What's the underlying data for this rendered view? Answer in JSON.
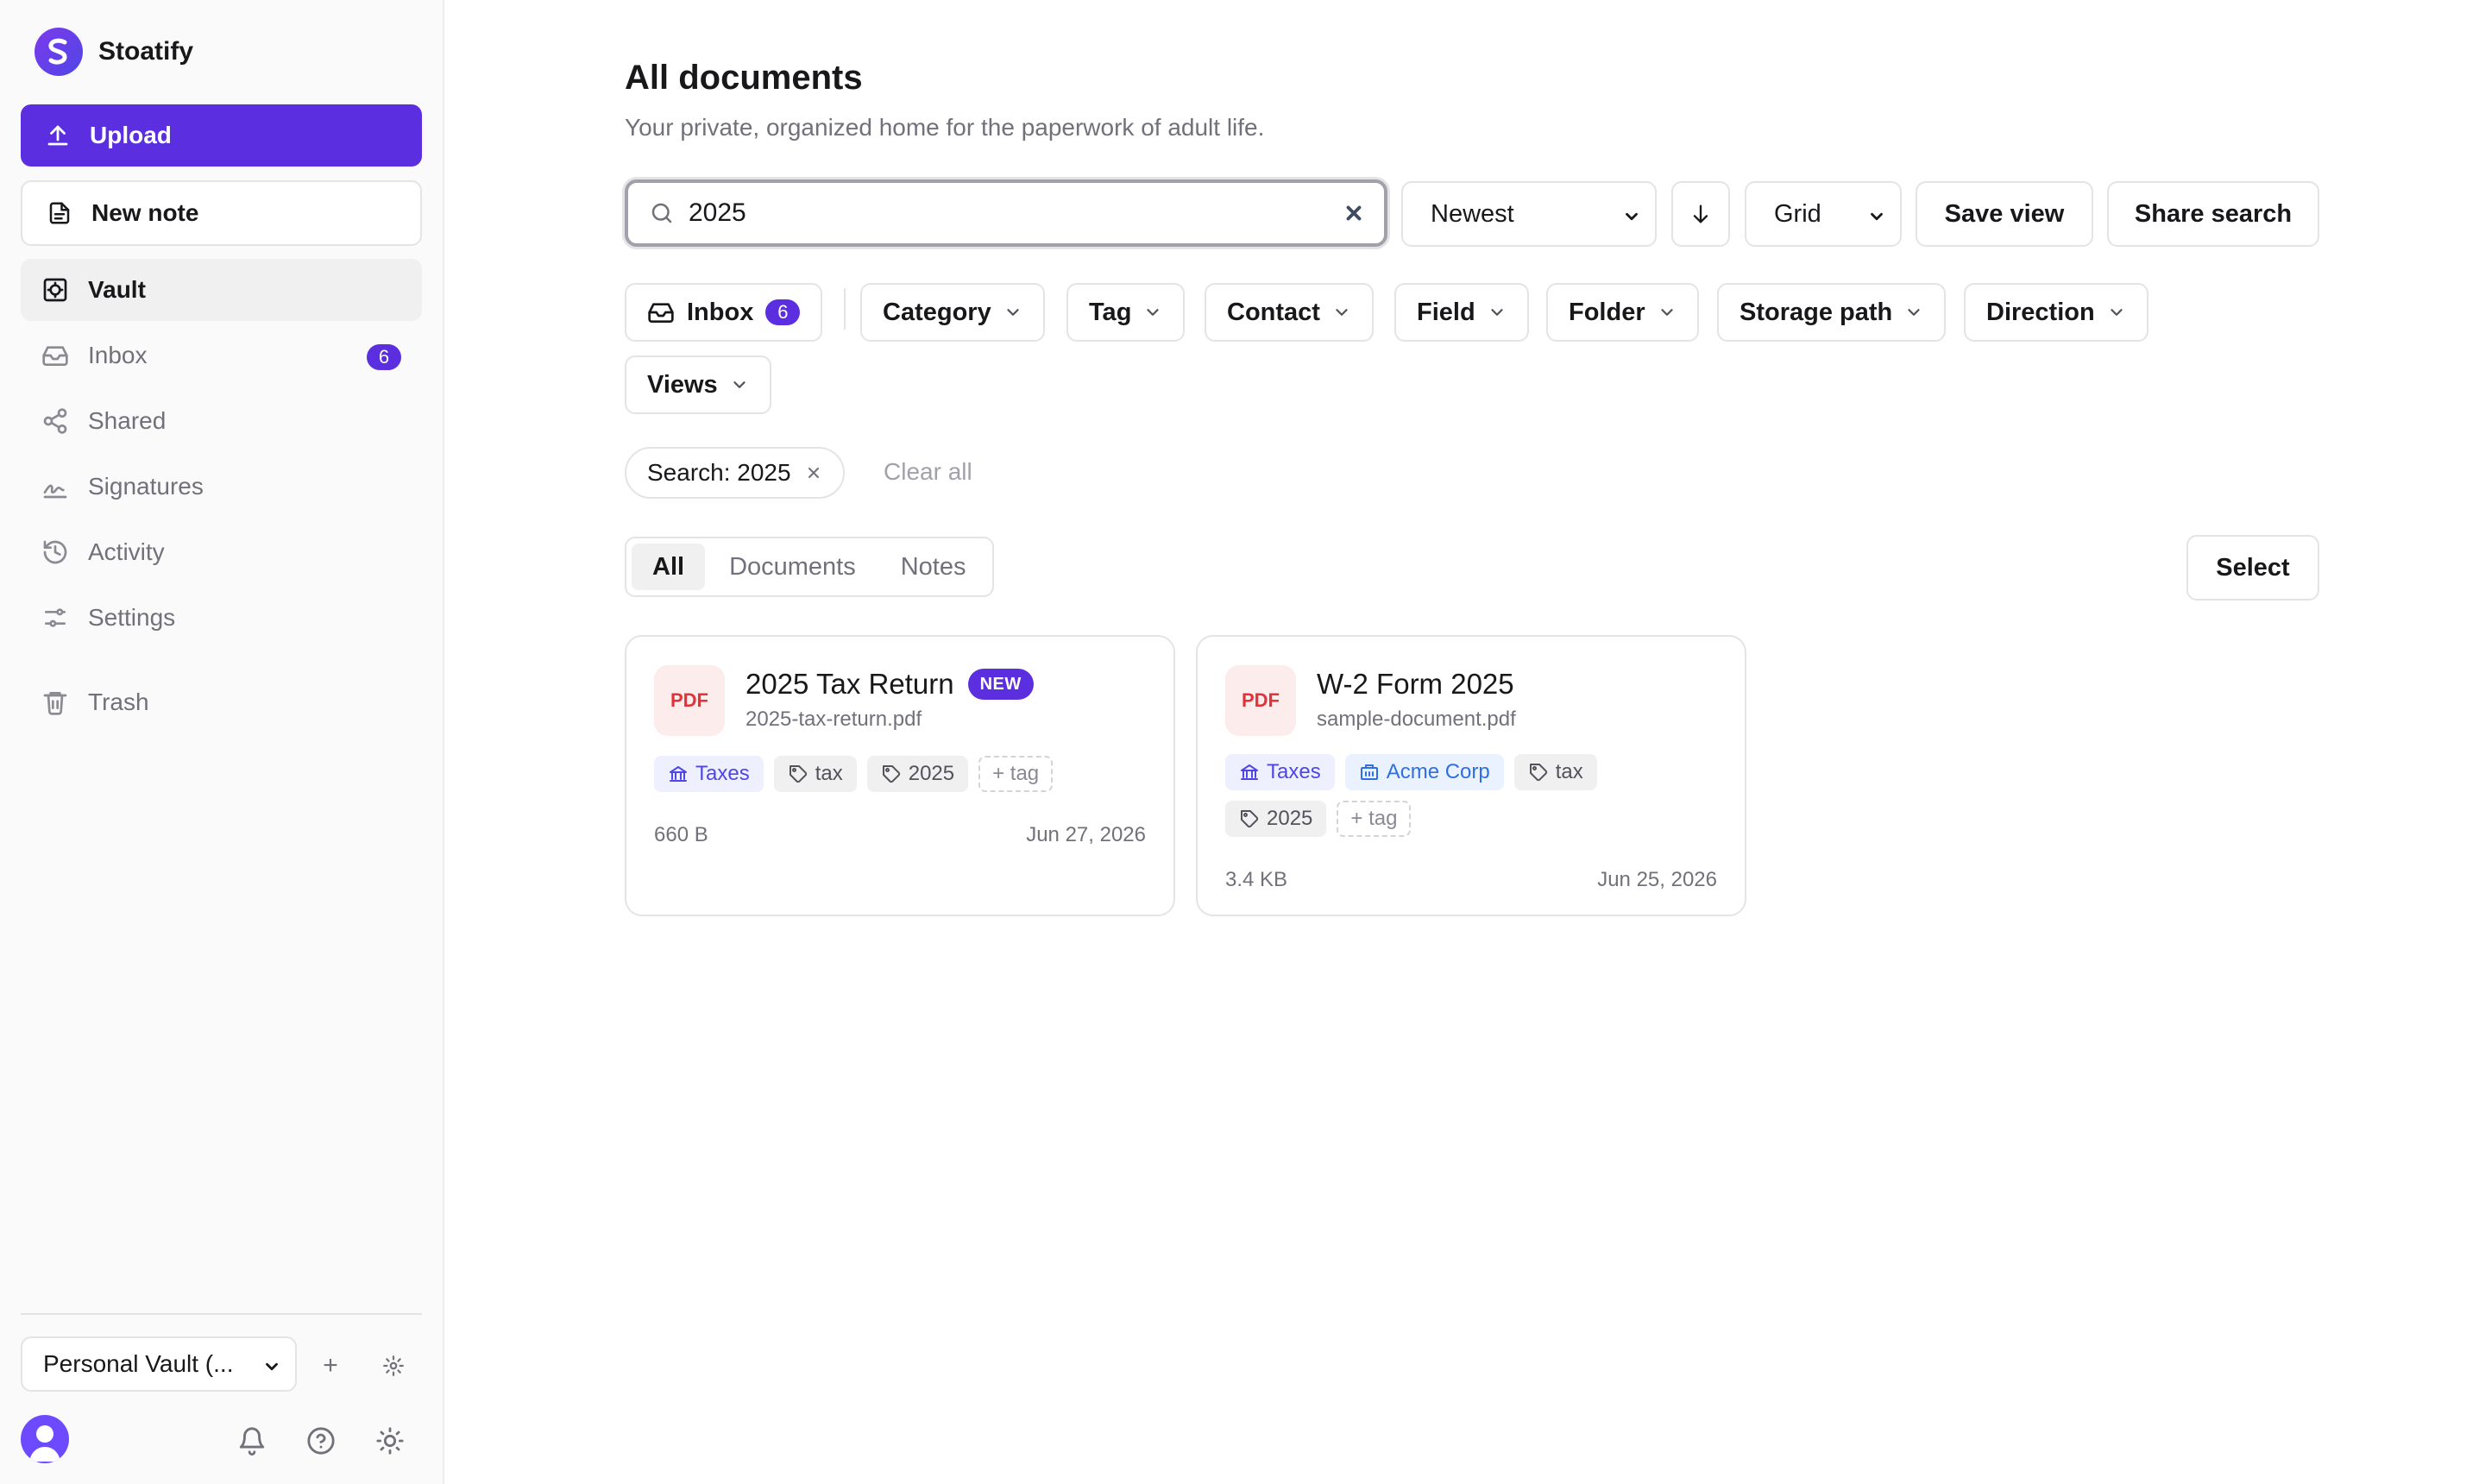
{
  "app": {
    "name": "Stoatify"
  },
  "sidebar": {
    "upload_label": "Upload",
    "new_note_label": "New note",
    "nav": [
      {
        "label": "Vault",
        "icon": "vault-icon",
        "active": true
      },
      {
        "label": "Inbox",
        "icon": "inbox-icon",
        "badge": "6"
      },
      {
        "label": "Shared",
        "icon": "share-icon"
      },
      {
        "label": "Signatures",
        "icon": "signature-icon"
      },
      {
        "label": "Activity",
        "icon": "history-icon"
      },
      {
        "label": "Settings",
        "icon": "sliders-icon"
      },
      {
        "label": "Trash",
        "icon": "trash-icon"
      }
    ],
    "vault_select": "Personal Vault (...",
    "add_symbol": "+"
  },
  "main": {
    "title": "All documents",
    "subtitle": "Your private, organized home for the paperwork of adult life.",
    "search": {
      "value": "2025",
      "placeholder": ""
    },
    "sort": "Newest",
    "view": "Grid",
    "save_view_label": "Save view",
    "share_search_label": "Share search",
    "filters": {
      "inbox": {
        "label": "Inbox",
        "count": "6"
      },
      "category": "Category",
      "tag": "Tag",
      "contact": "Contact",
      "field": "Field",
      "folder": "Folder",
      "storage_path": "Storage path",
      "direction": "Direction",
      "views": "Views"
    },
    "active_filter": "Search: 2025",
    "clear_all": "Clear all",
    "tabs": [
      "All",
      "Documents",
      "Notes"
    ],
    "select_label": "Select",
    "documents": [
      {
        "type": "PDF",
        "title": "2025 Tax Return",
        "badge": "NEW",
        "filename": "2025-tax-return.pdf",
        "category": "Taxes",
        "tags": [
          "tax",
          "2025"
        ],
        "add_tag": "+ tag",
        "size": "660 B",
        "date": "Jun 27, 2026"
      },
      {
        "type": "PDF",
        "title": "W-2 Form 2025",
        "filename": "sample-document.pdf",
        "category": "Taxes",
        "contact": "Acme Corp",
        "tags": [
          "tax",
          "2025"
        ],
        "add_tag": "+ tag",
        "size": "3.4 KB",
        "date": "Jun 25, 2026"
      }
    ]
  },
  "colors": {
    "accent": "#5b2ee0",
    "pdf_text": "#e0333a",
    "pdf_bg": "#fdecec",
    "category_text": "#4f46e5",
    "contact_text": "#2f6fe0"
  }
}
